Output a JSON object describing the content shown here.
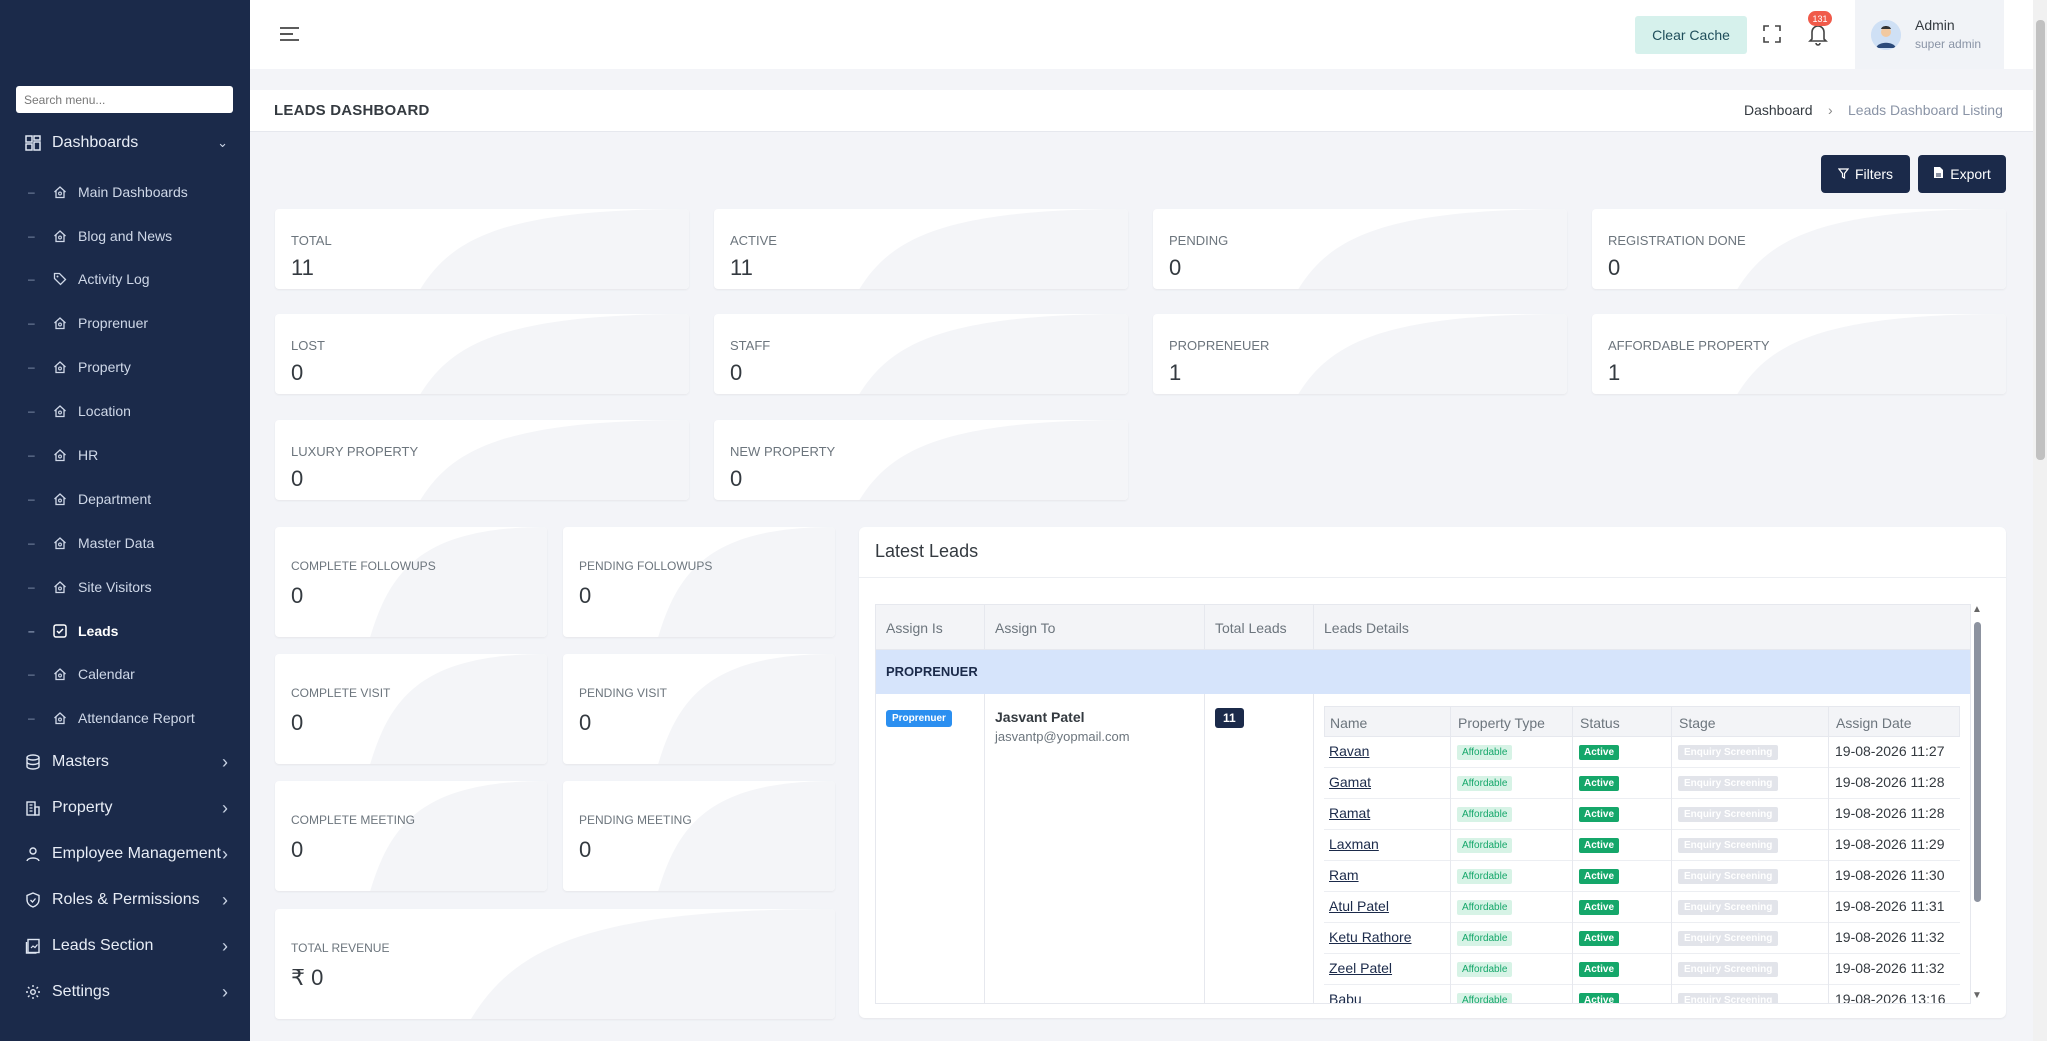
{
  "sidebar": {
    "search_placeholder": "Search menu...",
    "dashboards_label": "Dashboards",
    "sub_items": [
      {
        "label": "Main Dashboards"
      },
      {
        "label": "Blog and News"
      },
      {
        "label": "Activity Log"
      },
      {
        "label": "Proprenuer"
      },
      {
        "label": "Property"
      },
      {
        "label": "Location"
      },
      {
        "label": "HR"
      },
      {
        "label": "Department"
      },
      {
        "label": "Master Data"
      },
      {
        "label": "Site Visitors"
      },
      {
        "label": "Leads"
      },
      {
        "label": "Calendar"
      },
      {
        "label": "Attendance Report"
      }
    ],
    "groups": [
      {
        "label": "Masters"
      },
      {
        "label": "Property"
      },
      {
        "label": "Employee Management"
      },
      {
        "label": "Roles & Permissions"
      },
      {
        "label": "Leads Section"
      },
      {
        "label": "Settings"
      }
    ]
  },
  "topbar": {
    "clear_cache": "Clear Cache",
    "notification_count": "131",
    "user_name": "Admin",
    "user_role": "super admin"
  },
  "page": {
    "title": "LEADS DASHBOARD",
    "breadcrumb_home": "Dashboard",
    "breadcrumb_sep": "›",
    "breadcrumb_current": "Leads Dashboard Listing",
    "filters_label": "Filters",
    "export_label": "Export"
  },
  "stats": [
    {
      "label": "TOTAL",
      "value": "11"
    },
    {
      "label": "ACTIVE",
      "value": "11"
    },
    {
      "label": "PENDING",
      "value": "0"
    },
    {
      "label": "REGISTRATION DONE",
      "value": "0"
    },
    {
      "label": "LOST",
      "value": "0"
    },
    {
      "label": "STAFF",
      "value": "0"
    },
    {
      "label": "PROPRENEUER",
      "value": "1"
    },
    {
      "label": "AFFORDABLE PROPERTY",
      "value": "1"
    },
    {
      "label": "LUXURY PROPERTY",
      "value": "0"
    },
    {
      "label": "NEW PROPERTY",
      "value": "0"
    }
  ],
  "activity": [
    {
      "label": "COMPLETE FOLLOWUPS",
      "value": "0"
    },
    {
      "label": "PENDING FOLLOWUPS",
      "value": "0"
    },
    {
      "label": "COMPLETE VISIT",
      "value": "0"
    },
    {
      "label": "PENDING VISIT",
      "value": "0"
    },
    {
      "label": "COMPLETE MEETING",
      "value": "0"
    },
    {
      "label": "PENDING MEETING",
      "value": "0"
    },
    {
      "label": "TOTAL REVENUE",
      "value": "₹ 0"
    }
  ],
  "latest_leads": {
    "title": "Latest Leads",
    "headers": [
      "Assign Is",
      "Assign To",
      "Total Leads",
      "Leads Details"
    ],
    "group": "PROPRENUER",
    "role_badge": "Proprenuer",
    "assignee_name": "Jasvant Patel",
    "assignee_email": "jasvantp@yopmail.com",
    "total": "11",
    "inner_headers": [
      "Name",
      "Property Type",
      "Status",
      "Stage",
      "Assign Date"
    ],
    "rows": [
      {
        "name": "Ravan",
        "type": "Affordable",
        "status": "Active",
        "stage": "Enquiry Screening",
        "date": "19-08-2026 11:27"
      },
      {
        "name": "Gamat",
        "type": "Affordable",
        "status": "Active",
        "stage": "Enquiry Screening",
        "date": "19-08-2026 11:28"
      },
      {
        "name": "Ramat",
        "type": "Affordable",
        "status": "Active",
        "stage": "Enquiry Screening",
        "date": "19-08-2026 11:28"
      },
      {
        "name": "Laxman",
        "type": "Affordable",
        "status": "Active",
        "stage": "Enquiry Screening",
        "date": "19-08-2026 11:29"
      },
      {
        "name": "Ram",
        "type": "Affordable",
        "status": "Active",
        "stage": "Enquiry Screening",
        "date": "19-08-2026 11:30"
      },
      {
        "name": "Atul Patel",
        "type": "Affordable",
        "status": "Active",
        "stage": "Enquiry Screening",
        "date": "19-08-2026 11:31"
      },
      {
        "name": "Ketu Rathore",
        "type": "Affordable",
        "status": "Active",
        "stage": "Enquiry Screening",
        "date": "19-08-2026 11:32"
      },
      {
        "name": "Zeel Patel",
        "type": "Affordable",
        "status": "Active",
        "stage": "Enquiry Screening",
        "date": "19-08-2026 11:32"
      },
      {
        "name": "Babu",
        "type": "Affordable",
        "status": "Active",
        "stage": "Enquiry Screening",
        "date": "19-08-2026 13:16"
      }
    ]
  }
}
